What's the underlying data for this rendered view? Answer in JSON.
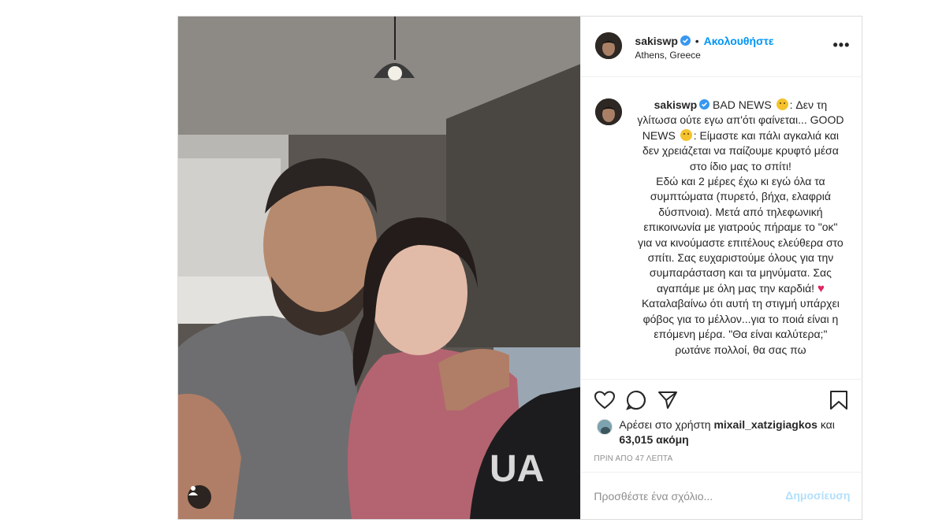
{
  "post": {
    "username": "sakiswp",
    "follow_label": "Ακολουθήστε",
    "separator": "•",
    "location": "Athens, Greece",
    "more_icon": "more-horizontal-icon",
    "caption": {
      "username": "sakiswp",
      "p1": "BAD NEWS",
      "p2": ": Δεν τη γλίτωσα ούτε εγω απ'ότι φαίνεται... GOOD NEWS",
      "p3": ": Είμαστε και πάλι αγκαλιά και δεν χρειάζεται να παίζουμε κρυφτό μέσα στο ίδιο μας το σπίτι!\nΕδώ και 2 μέρες έχω κι εγώ όλα τα συμπτώματα (πυρετό, βήχα, ελαφριά δύσπνοια). Μετά από τηλεφωνική επικοινωνία με γιατρούς πήραμε το \"οκ\" για να κινούμαστε επιτέλους ελεύθερα στο σπίτι. Σας ευχαριστούμε όλους για την συμπαράσταση και τα μηνύματα. Σας αγαπάμε με όλη μας την καρδιά!",
      "p4": "\nΚαταλαβαίνω ότι αυτή τη στιγμή υπάρχει φόβος για το μέλλον...για το ποιά είναι η επόμενη μέρα. \"Θα είναι καλύτερα;\" ρωτάνε πολλοί, θα σας πω"
    },
    "likes": {
      "prefix": "Αρέσει στο χρήστη",
      "user": "mixail_xatzigiagkos",
      "mid": "και",
      "count": "63,015 ακόμη"
    },
    "time": "ΠΡΙΝ ΑΠΟ 47 ΛΕΠΤΑ",
    "comment": {
      "placeholder": "Προσθέστε ένα σχόλιο...",
      "post_label": "Δημοσίευση"
    }
  },
  "icons": {
    "like": "heart-outline-icon",
    "comment": "comment-bubble-icon",
    "share": "paper-plane-icon",
    "save": "bookmark-icon",
    "tag": "user-tag-icon",
    "verified": "verified-badge-icon"
  },
  "colors": {
    "link_blue": "#0095f6",
    "disabled_blue": "#b2dffc",
    "muted": "#8e8e8e",
    "verified": "#3897f0"
  }
}
